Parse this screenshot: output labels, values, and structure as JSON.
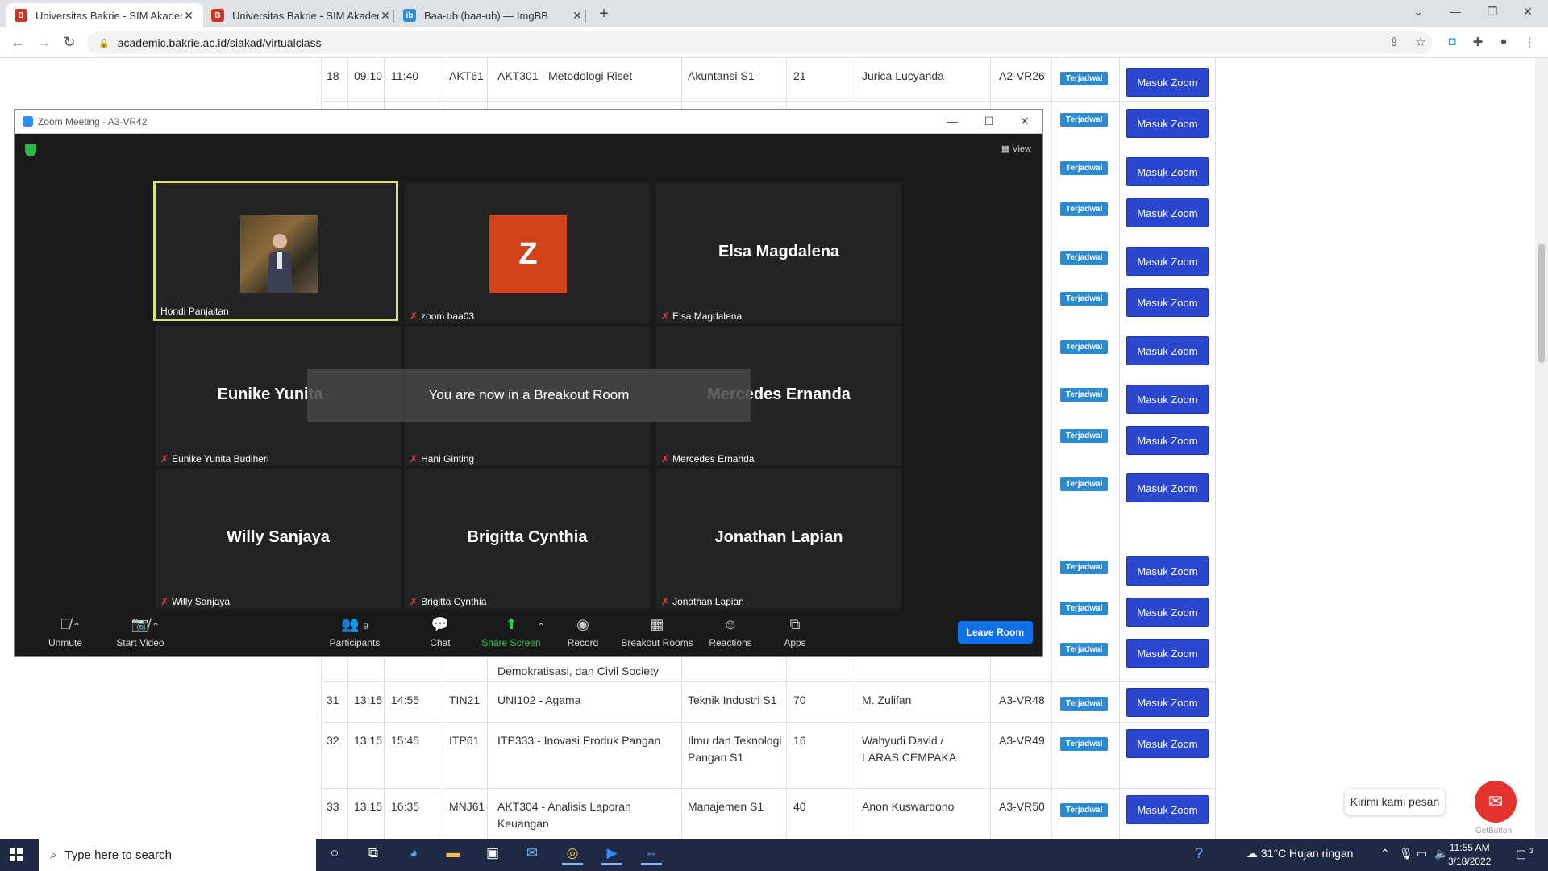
{
  "browser": {
    "tabs": [
      {
        "label": "Universitas Bakrie - SIM Akadem",
        "active": true
      },
      {
        "label": "Universitas Bakrie - SIM Akadem",
        "active": false
      },
      {
        "label": "Baa-ub (baa-ub) — ImgBB",
        "active": false
      }
    ],
    "new_tab": "+",
    "url": "academic.bakrie.ac.id/siakad/virtualclass"
  },
  "table": {
    "status_label": "Terjadwal",
    "action_label": "Masuk Zoom",
    "top_row": {
      "no": "18",
      "start": "09:10",
      "end": "11:40",
      "class": "AKT61",
      "course": "AKT301 - Metodologi Riset",
      "program": "Akuntansi S1",
      "count": "21",
      "lecturer": "Jurica Lucyanda",
      "room": "A2-VR26"
    },
    "partial_row_course": "Demokratisasi, dan Civil Society",
    "rows": [
      {
        "no": "31",
        "start": "13:15",
        "end": "14:55",
        "class": "TIN21",
        "course": "UNI102 - Agama",
        "program": "Teknik Industri S1",
        "count": "70",
        "lecturer": "M. Zulifan",
        "room": "A3-VR48"
      },
      {
        "no": "32",
        "start": "13:15",
        "end": "15:45",
        "class": "ITP61",
        "course": "ITP333 - Inovasi Produk Pangan",
        "program": "Ilmu dan Teknologi Pangan S1",
        "count": "16",
        "lecturer": "Wahyudi David / LARAS CEMPAKA",
        "room": "A3-VR49"
      },
      {
        "no": "33",
        "start": "13:15",
        "end": "16:35",
        "class": "MNJ61",
        "course": "AKT304 - Analisis Laporan Keuangan",
        "program": "Manajemen S1",
        "count": "40",
        "lecturer": "Anon Kuswardono",
        "room": "A3-VR50"
      }
    ]
  },
  "zoom": {
    "title": "Zoom Meeting - A3-VR42",
    "view_label": "View",
    "participants": [
      {
        "name": "Hondi Panjaitan",
        "big": "",
        "muted": false,
        "active": true
      },
      {
        "name": "zoom baa03",
        "big": "",
        "muted": true,
        "avatar": "Z"
      },
      {
        "name": "Elsa Magdalena",
        "big": "Elsa Magdalena",
        "muted": true
      },
      {
        "name": "Eunike Yunita Budiheri",
        "big": "Eunike  Yunita",
        "muted": true
      },
      {
        "name": "Hani Ginting",
        "big": "",
        "muted": true
      },
      {
        "name": "Mercedes Ernanda",
        "big": "Mercedes Ernanda",
        "muted": true
      },
      {
        "name": "Willy Sanjaya",
        "big": "Willy Sanjaya",
        "muted": true
      },
      {
        "name": "Brigitta Cynthia",
        "big": "Brigitta Cynthia",
        "muted": true
      },
      {
        "name": "Jonathan Lapian",
        "big": "Jonathan Lapian",
        "muted": true
      }
    ],
    "toast": "You are now in a Breakout Room",
    "toolbar": {
      "unmute": "Unmute",
      "start_video": "Start Video",
      "participants": "Participants",
      "participant_count": "9",
      "chat": "Chat",
      "share_screen": "Share Screen",
      "record": "Record",
      "breakout_rooms": "Breakout Rooms",
      "reactions": "Reactions",
      "apps": "Apps",
      "leave": "Leave Room"
    }
  },
  "chat_widget": {
    "label": "Kirimi kami pesan",
    "footer": "GetButton"
  },
  "taskbar": {
    "search_placeholder": "Type here to search",
    "weather": "31°C  Hujan ringan",
    "time": "11:55 AM",
    "date": "3/18/2022",
    "notifications": "3"
  },
  "colors": {
    "badge": "#2a8bd2",
    "zoom_button": "#2b47cf",
    "leave_button": "#0e71eb",
    "active_speaker": "#d9e66b",
    "muted_icon": "#e0443e"
  }
}
